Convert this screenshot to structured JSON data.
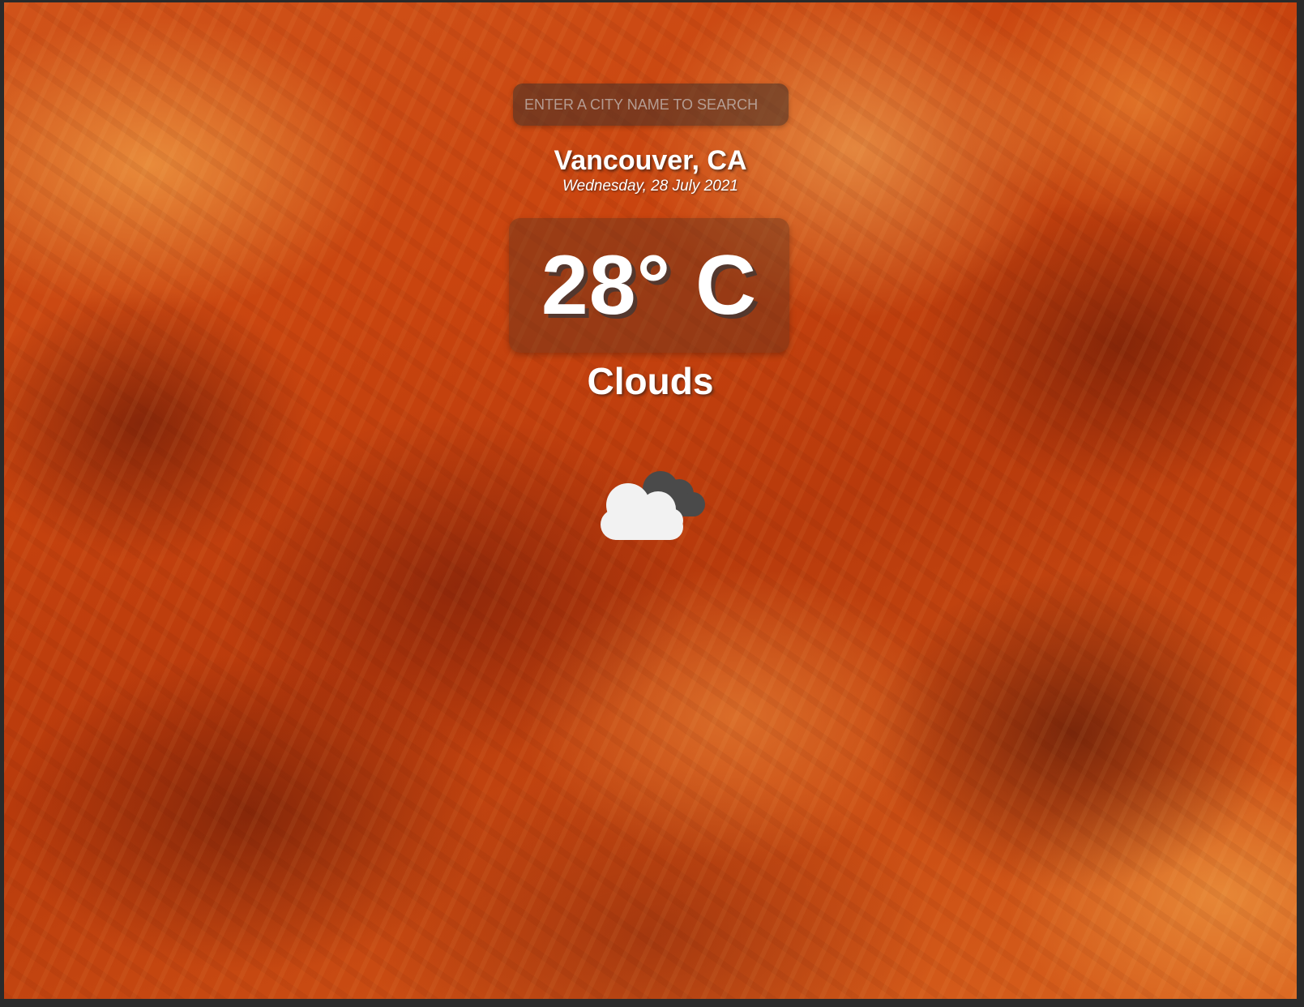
{
  "search": {
    "placeholder": "ENTER A CITY NAME TO SEARCH"
  },
  "weather": {
    "location": "Vancouver, CA",
    "date": "Wednesday, 28 July 2021",
    "temperature": "28° C",
    "condition": "Clouds",
    "icon": "clouds-icon"
  },
  "colors": {
    "background_theme": "#c9440f",
    "text": "#ffffff",
    "cloud_light": "#f2f2f2",
    "cloud_dark": "#4a4a4a"
  }
}
